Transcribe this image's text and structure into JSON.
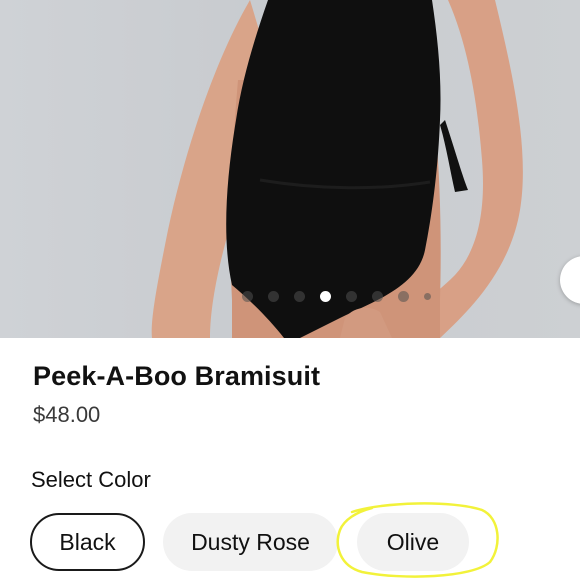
{
  "product": {
    "title": "Peek-A-Boo Bramisuit",
    "price": "$48.00"
  },
  "carousel": {
    "dot_count": 8,
    "active_index": 3
  },
  "color_picker": {
    "label": "Select Color",
    "options": [
      {
        "label": "Black",
        "selected": true
      },
      {
        "label": "Dusty Rose",
        "selected": false
      },
      {
        "label": "Olive",
        "selected": false
      }
    ]
  },
  "annotation": {
    "highlight_color": "#f2f23a",
    "highlighted_option": "Olive"
  },
  "icons": {
    "next_arrow": "chevron-right-icon"
  }
}
